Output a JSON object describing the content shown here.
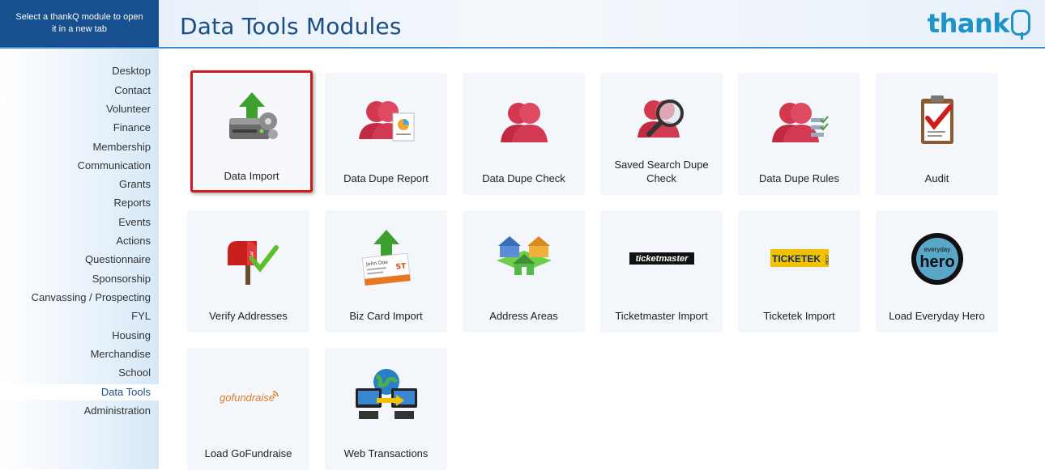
{
  "header": {
    "select_hint": "Select a thankQ module to open it in a new tab",
    "title": "Data Tools Modules",
    "logo": "thank"
  },
  "sidebar": {
    "items": [
      {
        "label": "Desktop"
      },
      {
        "label": "Contact"
      },
      {
        "label": "Volunteer"
      },
      {
        "label": "Finance"
      },
      {
        "label": "Membership"
      },
      {
        "label": "Communication"
      },
      {
        "label": "Grants"
      },
      {
        "label": "Reports"
      },
      {
        "label": "Events"
      },
      {
        "label": "Actions"
      },
      {
        "label": "Questionnaire"
      },
      {
        "label": "Sponsorship"
      },
      {
        "label": "Canvassing / Prospecting"
      },
      {
        "label": "FYL"
      },
      {
        "label": "Housing"
      },
      {
        "label": "Merchandise"
      },
      {
        "label": "School"
      },
      {
        "label": "Data Tools",
        "active": true
      },
      {
        "label": "Administration"
      }
    ]
  },
  "modules": [
    {
      "label": "Data Import",
      "icon": "data-import-icon",
      "selected": true
    },
    {
      "label": "Data Dupe Report",
      "icon": "dupe-report-icon"
    },
    {
      "label": "Data Dupe Check",
      "icon": "dupe-check-icon"
    },
    {
      "label": "Saved Search Dupe Check",
      "icon": "saved-search-icon"
    },
    {
      "label": "Data Dupe Rules",
      "icon": "dupe-rules-icon"
    },
    {
      "label": "Audit",
      "icon": "audit-clipboard-icon"
    },
    {
      "label": "Verify Addresses",
      "icon": "mailbox-icon"
    },
    {
      "label": "Biz Card Import",
      "icon": "biz-card-icon"
    },
    {
      "label": "Address Areas",
      "icon": "houses-icon"
    },
    {
      "label": "Ticketmaster Import",
      "icon": "ticketmaster-logo-icon",
      "logo_text": "ticketmaster"
    },
    {
      "label": "Ticketek Import",
      "icon": "ticketek-logo-icon",
      "logo_text": "TICKETEK",
      "logo_sub": ".COM"
    },
    {
      "label": "Load Everyday Hero",
      "icon": "everyday-hero-logo-icon",
      "logo_text": "hero",
      "logo_sub": "everyday"
    },
    {
      "label": "Load GoFundraise",
      "icon": "gofundraise-logo-icon",
      "logo_text": "gofundraise"
    },
    {
      "label": "Web Transactions",
      "icon": "web-transactions-icon"
    }
  ],
  "colors": {
    "brand": "#1b4e85",
    "accent": "#3b8fd6",
    "selection": "#d11a1a",
    "tile_bg": "#f3f6fa"
  }
}
